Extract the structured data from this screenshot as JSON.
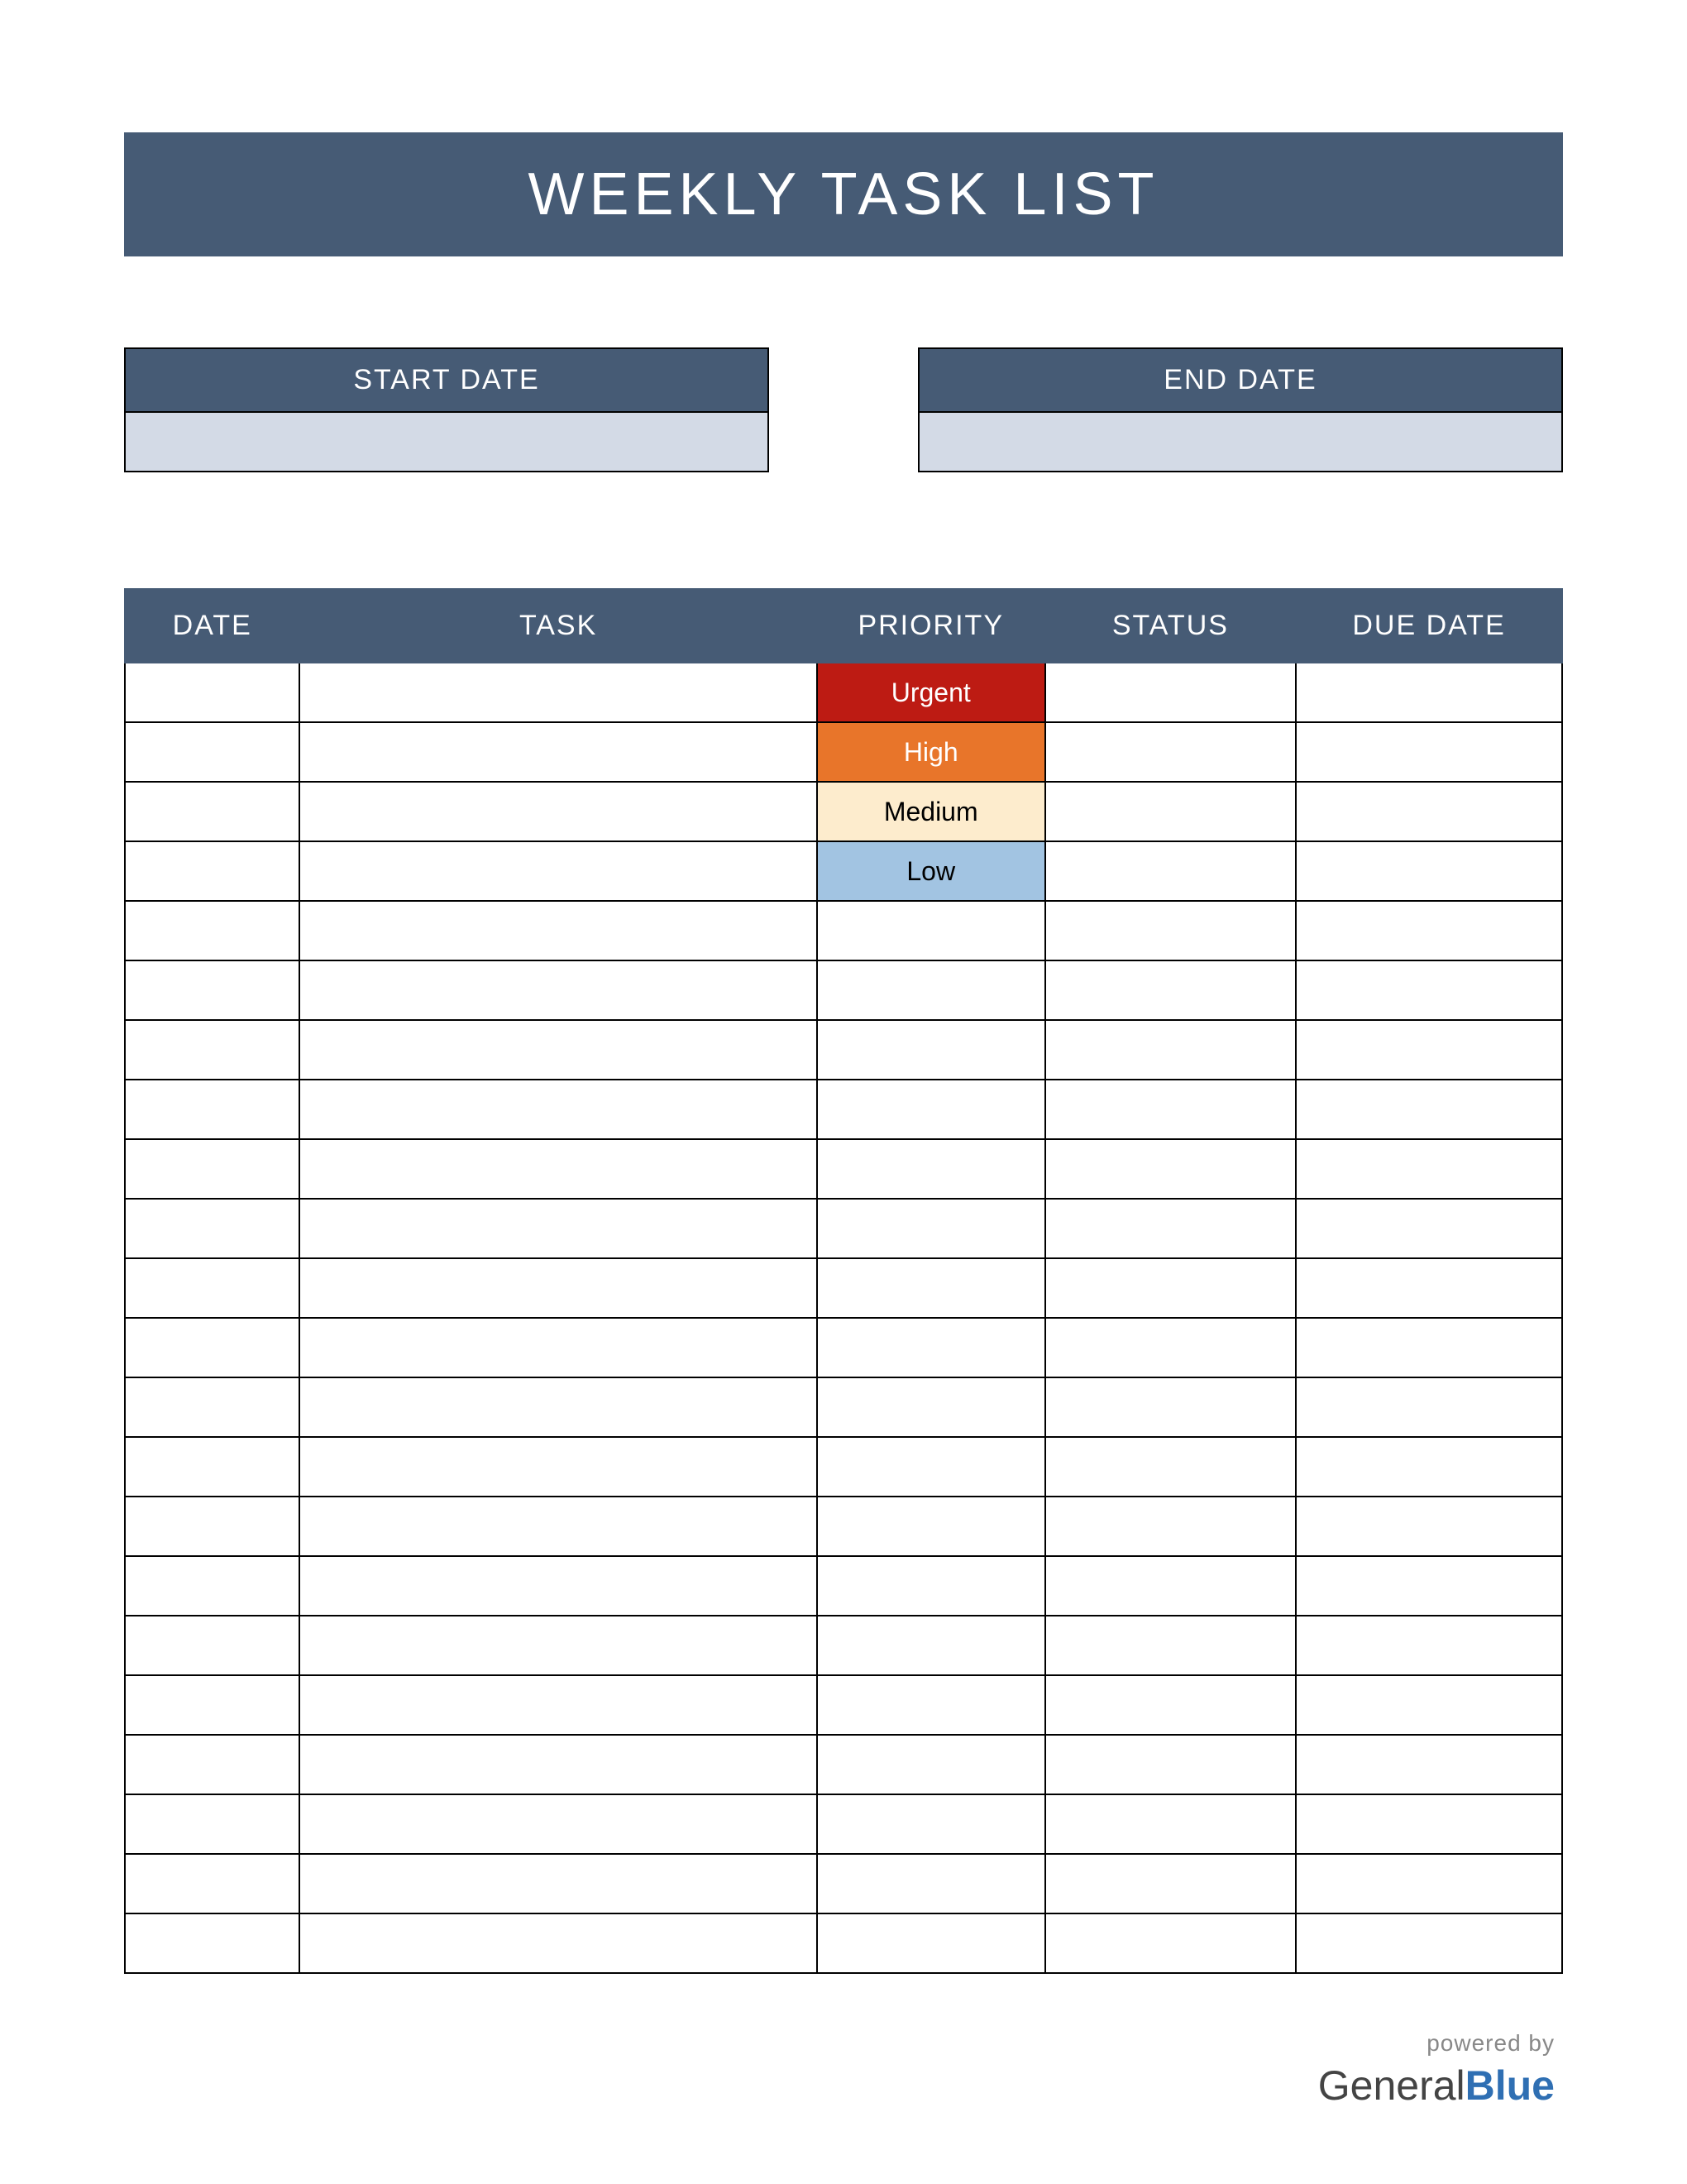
{
  "title": "WEEKLY TASK LIST",
  "dates": {
    "start_label": "START DATE",
    "start_value": "",
    "end_label": "END DATE",
    "end_value": ""
  },
  "columns": {
    "date": "DATE",
    "task": "TASK",
    "priority": "PRIORITY",
    "status": "STATUS",
    "due_date": "DUE DATE"
  },
  "priority_levels": {
    "urgent": "Urgent",
    "high": "High",
    "medium": "Medium",
    "low": "Low"
  },
  "row_count": 22,
  "colors": {
    "header_bg": "#465b75",
    "date_value_bg": "#d3dae6",
    "urgent": "#bd1b13",
    "high": "#e8752a",
    "medium": "#fdeccd",
    "low": "#a2c4e2"
  },
  "footer": {
    "powered": "powered by",
    "brand_general": "General",
    "brand_blue": "Blue"
  }
}
